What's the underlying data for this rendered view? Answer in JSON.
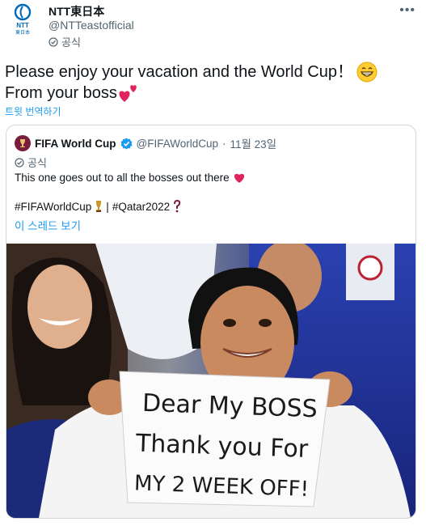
{
  "tweet": {
    "author_name": "NTT東日本",
    "author_handle": "@NTTeastofficial",
    "official_label": "공식",
    "line1": "Please enjoy your vacation and the World Cup！",
    "line2": "From your boss",
    "translate_label": "트윗 번역하기",
    "logo_text": "NTT",
    "logo_sub": "東日本"
  },
  "quote": {
    "author_name": "FIFA World Cup",
    "author_handle": "@FIFAWorldCup",
    "separator": "·",
    "date": "11월 23일",
    "official_label": "공식",
    "text": "This one goes out to all the bosses out there",
    "hashtag1": "#FIFAWorldCup",
    "divider": "|",
    "hashtag2": "#Qatar2022",
    "thread_link": "이 스레드 보기"
  },
  "image": {
    "sign_line1": "Dear My BOSS",
    "sign_line2": "Thank you For",
    "sign_line3": "MY 2 WEEK OFF!"
  },
  "colors": {
    "link": "#1d9bf0",
    "verified": "#1d9bf0",
    "heart": "#e0245e",
    "ntt_blue": "#0068b7"
  }
}
